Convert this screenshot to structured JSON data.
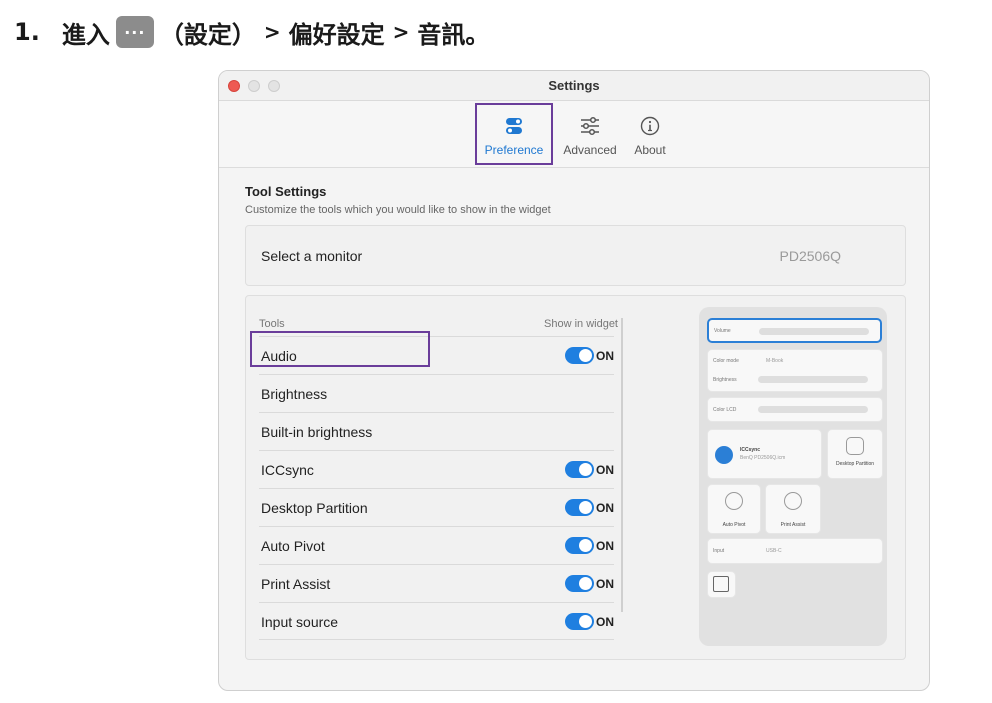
{
  "instruction": {
    "number": "1.",
    "enter": "進入",
    "dots": "···",
    "settings": "（設定）",
    "sep": ">",
    "preferences": "偏好設定",
    "audio": "音訊。"
  },
  "window": {
    "title": "Settings",
    "tabs": [
      {
        "label": "Preference",
        "icon": "toggles-icon",
        "selected": true
      },
      {
        "label": "Advanced",
        "icon": "sliders-icon"
      },
      {
        "label": "About",
        "icon": "info-icon"
      }
    ]
  },
  "tool_settings": {
    "title": "Tool Settings",
    "description": "Customize the tools which you would like to show in the widget",
    "select_monitor_label": "Select a monitor",
    "monitor_value": "PD2506Q",
    "col_tools": "Tools",
    "col_show": "Show in widget",
    "rows": [
      {
        "name": "Audio",
        "toggle": "ON"
      },
      {
        "name": "Brightness",
        "toggle": ""
      },
      {
        "name": "Built-in brightness",
        "toggle": ""
      },
      {
        "name": "ICCsync",
        "toggle": "ON"
      },
      {
        "name": "Desktop Partition",
        "toggle": "ON"
      },
      {
        "name": "Auto Pivot",
        "toggle": "ON"
      },
      {
        "name": "Print Assist",
        "toggle": "ON"
      },
      {
        "name": "Input source",
        "toggle": "ON"
      }
    ]
  },
  "widget_preview": {
    "volume": "Volume",
    "color_mode": "Color mode",
    "color_mode_value": "M-Book",
    "brightness": "Brightness",
    "color_lcd": "Color LCD",
    "iccsync": "ICCsync",
    "iccsync_sub": "BenQ PD2506Q.icm",
    "desktop_partition": "Desktop Partition",
    "auto_pivot": "Auto Pivot",
    "print_assist": "Print Assist",
    "input": "Input",
    "input_value": "USB-C"
  },
  "colors": {
    "accent": "#1f7fe0",
    "highlight": "#6a3d9a"
  }
}
